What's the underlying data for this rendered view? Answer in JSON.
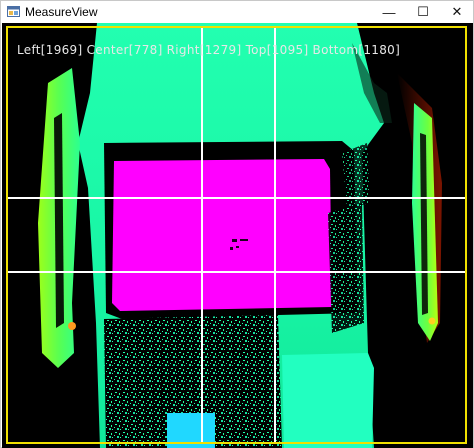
{
  "window": {
    "title": "MeasureView",
    "icon": "app-window-icon",
    "controls": {
      "minimize_icon": "minimize-icon",
      "maximize_icon": "maximize-icon",
      "close_icon": "close-icon",
      "minimize_glyph": "—",
      "maximize_glyph": "☐",
      "close_glyph": "✕"
    }
  },
  "measurement": {
    "overlay_text": "Left[1969] Center[778] Right[1279] Top[1095] Bottom[1180]",
    "border_color": "#f0e000",
    "guide_line_color": "#ffffff"
  },
  "colors": {
    "background": "#000000",
    "depth_near": "#ff00ff",
    "depth_mid": "#1fffa8",
    "depth_far": "#7fff00",
    "depth_edge": "#ff3000"
  }
}
